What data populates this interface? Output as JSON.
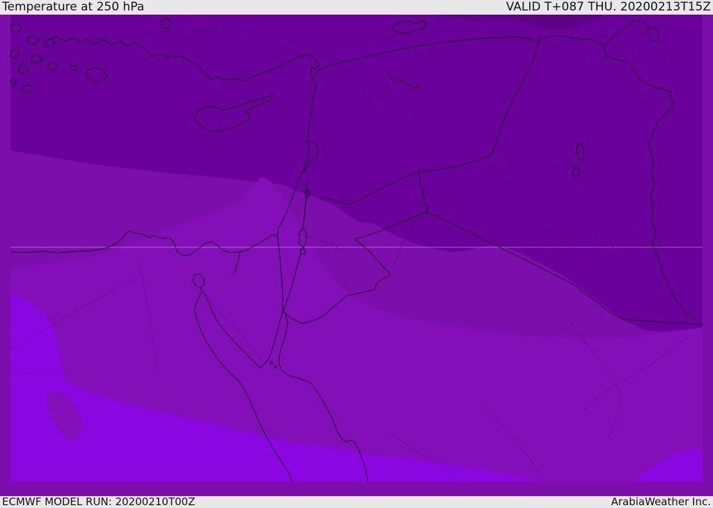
{
  "header": {
    "title": "Temperature at 250 hPa",
    "valid_label": "VALID T+087 THU. 20200213T15Z"
  },
  "footer": {
    "model_run_label": "ECMWF MODEL RUN: 20200210T00Z",
    "credit": "ArabiaWeather Inc."
  },
  "map": {
    "parameter": "Temperature",
    "level": "250 hPa",
    "model": "ECMWF",
    "region": "Middle East / Eastern Mediterranean",
    "bands": {
      "t0": {
        "name": "coldest-band",
        "color": "#5e0187"
      },
      "t1": {
        "name": "very-cold-band",
        "color": "#6a019b"
      },
      "t2": {
        "name": "cold-band",
        "color": "#7c0eac"
      },
      "t3": {
        "name": "milder-band",
        "color": "#830fb8"
      },
      "t4": {
        "name": "warmest-band",
        "color": "#8a07e1"
      }
    },
    "colors": {
      "border": "#16001a",
      "dotted": "#1d0524",
      "graticule": "#d8c6e6",
      "bar_background": "#e9e8e8",
      "bar_text": "#111111"
    }
  }
}
